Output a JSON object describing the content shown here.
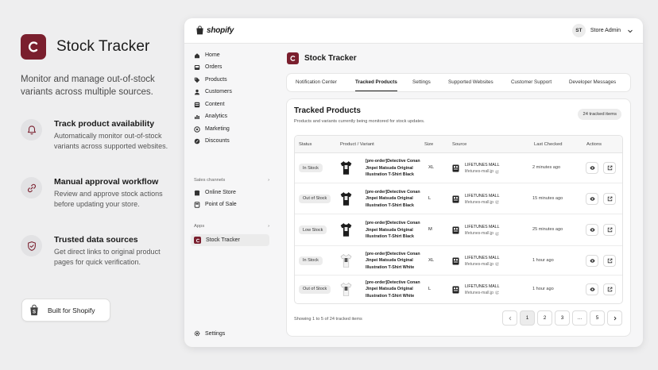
{
  "brand": {
    "title": "Stock Tracker",
    "tagline": "Monitor and manage out-of-stock variants across multiple sources.",
    "color": "#7a1f2e"
  },
  "features": [
    {
      "icon": "bell-icon",
      "title": "Track product availability",
      "desc": "Automatically monitor out-of-stock variants across supported websites."
    },
    {
      "icon": "link-icon",
      "title": "Manual approval workflow",
      "desc": "Review and approve stock actions before updating your store."
    },
    {
      "icon": "shield-check-icon",
      "title": "Trusted data sources",
      "desc": "Get direct links to original product pages for quick verification."
    }
  ],
  "built_badge": "Built for Shopify",
  "topbar": {
    "logo_text": "shopify",
    "avatar": "ST",
    "store_name": "Store Admin"
  },
  "sidebar": {
    "items": [
      {
        "label": "Home",
        "icon": "home-icon"
      },
      {
        "label": "Orders",
        "icon": "inbox-icon"
      },
      {
        "label": "Products",
        "icon": "tag-icon"
      },
      {
        "label": "Customers",
        "icon": "person-icon"
      },
      {
        "label": "Content",
        "icon": "content-icon"
      },
      {
        "label": "Analytics",
        "icon": "chart-icon"
      },
      {
        "label": "Marketing",
        "icon": "target-icon"
      },
      {
        "label": "Discounts",
        "icon": "discount-icon"
      }
    ],
    "sales_channels_label": "Sales channels",
    "channels": [
      {
        "label": "Online Store"
      },
      {
        "label": "Point of Sale"
      }
    ],
    "apps_label": "Apps",
    "app": {
      "label": "Stock Tracker"
    },
    "settings_label": "Settings"
  },
  "page": {
    "title": "Stock Tracker"
  },
  "tabs": [
    {
      "label": "Notification Center"
    },
    {
      "label": "Tracked Products",
      "active": true
    },
    {
      "label": "Settings"
    },
    {
      "label": "Supported Websites"
    },
    {
      "label": "Customer Support"
    },
    {
      "label": "Developer Messages"
    }
  ],
  "card": {
    "title": "Tracked Products",
    "subtitle": "Products and variants currently being monitored for stock updates.",
    "count_badge": "24 tracked items"
  },
  "table": {
    "headers": {
      "status": "Status",
      "product": "Product / Variant",
      "size": "Size",
      "source": "Source",
      "last_checked": "Last Checked",
      "actions": "Actions"
    },
    "rows": [
      {
        "status": "In Stock",
        "product": "[pre-order]Detective Conan Jinpei Matsuda Original Illustration T-Shirt Black",
        "shirt": "black",
        "size": "XL",
        "source": "LIFETUNES MALL",
        "url": "lifetunes-mall.jp",
        "checked": "2 minutes ago"
      },
      {
        "status": "Out of Stock",
        "product": "[pre-order]Detective Conan Jinpei Matsuda Original Illustration T-Shirt Black",
        "shirt": "black",
        "size": "L",
        "source": "LIFETUNES MALL",
        "url": "lifetunes-mall.jp",
        "checked": "15 minutes ago"
      },
      {
        "status": "Low Stock",
        "product": "[pre-order]Detective Conan Jinpei Matsuda Original Illustration T-Shirt Black",
        "shirt": "black",
        "size": "M",
        "source": "LIFETUNES MALL",
        "url": "lifetunes-mall.jp",
        "checked": "25 minutes ago"
      },
      {
        "status": "In Stock",
        "product": "[pre-order]Detective Conan Jinpei Matsuda Original Illustration T-Shirt White",
        "shirt": "white",
        "size": "XL",
        "source": "LIFETUNES MALL",
        "url": "lifetunes-mall.jp",
        "checked": "1 hour ago"
      },
      {
        "status": "Out of Stock",
        "product": "[pre-order]Detective Conan Jinpei Matsuda Original Illustration T-Shirt White",
        "shirt": "white",
        "size": "L",
        "source": "LIFETUNES MALL",
        "url": "lifetunes-mall.jp",
        "checked": "1 hour ago"
      }
    ]
  },
  "pagination": {
    "summary": "Showing 1 to 5 of 24 tracked items",
    "pages": [
      "1",
      "2",
      "3",
      "...",
      "5"
    ],
    "current": "1"
  }
}
